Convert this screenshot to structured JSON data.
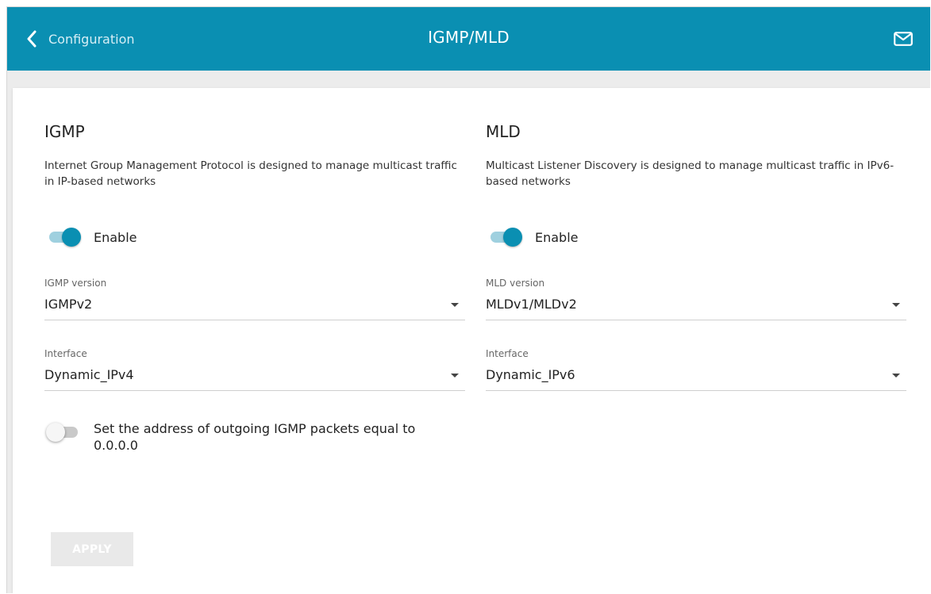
{
  "header": {
    "back_label": "Configuration",
    "title": "IGMP/MLD",
    "accent": "#0a8fb2"
  },
  "igmp": {
    "title": "IGMP",
    "description": "Internet Group Management Protocol is designed to manage multicast traffic in IP-based networks",
    "enable_label": "Enable",
    "enabled": true,
    "version_label": "IGMP version",
    "version_value": "IGMPv2",
    "interface_label": "Interface",
    "interface_value": "Dynamic_IPv4",
    "outgoing_label": "Set the address of outgoing IGMP packets equal to 0.0.0.0",
    "outgoing_enabled": false
  },
  "mld": {
    "title": "MLD",
    "description": "Multicast Listener Discovery is designed to manage multicast traffic in IPv6-based networks",
    "enable_label": "Enable",
    "enabled": true,
    "version_label": "MLD version",
    "version_value": "MLDv1/MLDv2",
    "interface_label": "Interface",
    "interface_value": "Dynamic_IPv6"
  },
  "actions": {
    "apply_label": "APPLY"
  }
}
